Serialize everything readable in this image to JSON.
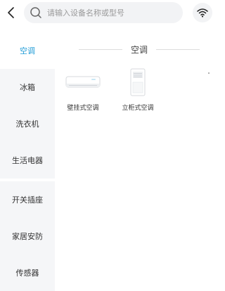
{
  "header": {
    "search_placeholder": "请输入设备名称或型号"
  },
  "sidebar": {
    "items": [
      {
        "label": "空调",
        "active": true
      },
      {
        "label": "冰箱",
        "active": false
      },
      {
        "label": "洗衣机",
        "active": false
      },
      {
        "label": "生活电器",
        "active": false
      },
      {
        "label": "开关插座",
        "active": false
      },
      {
        "label": "家居安防",
        "active": false
      },
      {
        "label": "传感器",
        "active": false
      }
    ]
  },
  "main": {
    "section_title": "空调",
    "products": [
      {
        "label": "壁挂式空调",
        "icon": "wall-ac-icon"
      },
      {
        "label": "立柜式空调",
        "icon": "floor-ac-icon"
      }
    ]
  },
  "colors": {
    "accent": "#1f9bd6",
    "sidebar_bg": "#f5f6f8",
    "search_bg": "#f2f3f5"
  }
}
